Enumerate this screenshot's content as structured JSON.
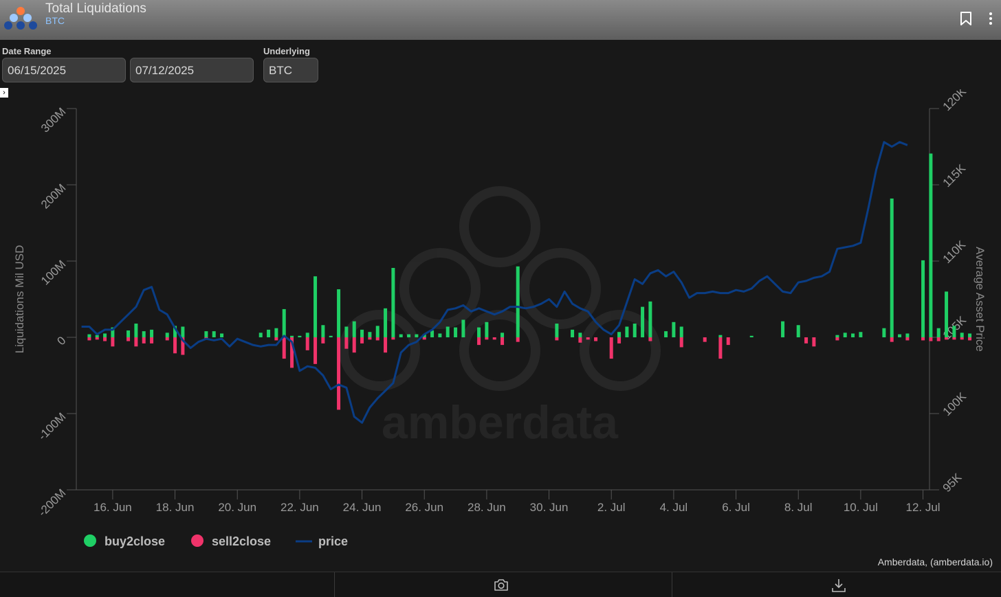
{
  "header": {
    "title": "Total Liquidations",
    "subtitle": "BTC",
    "bookmark_icon": "bookmark-icon",
    "menu_icon": "more-vertical-icon"
  },
  "filters": {
    "date_range_label": "Date Range",
    "start_date": "06/15/2025",
    "end_date": "07/12/2025",
    "underlying_label": "Underlying",
    "underlying": "BTC"
  },
  "credit": "Amberdata, (amberdata.io)",
  "footer": {
    "camera_icon": "camera-icon",
    "download_icon": "download-icon"
  },
  "colors": {
    "buy": "#1fcf65",
    "sell": "#f0336a",
    "price": "#0a3d85",
    "background": "#181818"
  },
  "chart_data": {
    "type": "bar",
    "ylabel": "Liquidations Mil USD",
    "y2label": "Average Asset Price",
    "ylim": [
      -200,
      300
    ],
    "y2lim": [
      95000,
      120000
    ],
    "yticks": [
      "300M",
      "200M",
      "100M",
      "0",
      "-100M",
      "-200M"
    ],
    "y2ticks": [
      "120K",
      "115K",
      "110K",
      "105K",
      "100K",
      "95K"
    ],
    "xticks": [
      "16. Jun",
      "18. Jun",
      "20. Jun",
      "22. Jun",
      "24. Jun",
      "26. Jun",
      "28. Jun",
      "30. Jun",
      "2. Jul",
      "4. Jul",
      "6. Jul",
      "8. Jul",
      "10. Jul",
      "12. Jul"
    ],
    "xlim": [
      "2025-06-14T20:00",
      "2025-07-12T05:00"
    ],
    "watermark": "amberdata",
    "legend": {
      "position": "bottom-left",
      "entries": [
        "buy2close",
        "sell2close",
        "price"
      ]
    },
    "series": [
      {
        "name": "buy2close",
        "unit": "M USD",
        "points": [
          [
            "2025-06-15T06:00",
            4
          ],
          [
            "2025-06-15T12:00",
            3
          ],
          [
            "2025-06-15T18:00",
            5
          ],
          [
            "2025-06-16T00:00",
            13
          ],
          [
            "2025-06-16T12:00",
            9
          ],
          [
            "2025-06-16T18:00",
            18
          ],
          [
            "2025-06-17T00:00",
            8
          ],
          [
            "2025-06-17T06:00",
            10
          ],
          [
            "2025-06-17T18:00",
            6
          ],
          [
            "2025-06-18T00:00",
            15
          ],
          [
            "2025-06-18T06:00",
            14
          ],
          [
            "2025-06-19T00:00",
            8
          ],
          [
            "2025-06-19T06:00",
            8
          ],
          [
            "2025-06-19T12:00",
            5
          ],
          [
            "2025-06-20T18:00",
            6
          ],
          [
            "2025-06-21T00:00",
            10
          ],
          [
            "2025-06-21T06:00",
            12
          ],
          [
            "2025-06-21T12:00",
            37
          ],
          [
            "2025-06-21T18:00",
            2
          ],
          [
            "2025-06-22T00:00",
            2
          ],
          [
            "2025-06-22T06:00",
            6
          ],
          [
            "2025-06-22T12:00",
            80
          ],
          [
            "2025-06-22T18:00",
            16
          ],
          [
            "2025-06-23T00:00",
            2
          ],
          [
            "2025-06-23T06:00",
            63
          ],
          [
            "2025-06-23T12:00",
            14
          ],
          [
            "2025-06-23T18:00",
            21
          ],
          [
            "2025-06-24T00:00",
            10
          ],
          [
            "2025-06-24T06:00",
            7
          ],
          [
            "2025-06-24T12:00",
            15
          ],
          [
            "2025-06-24T18:00",
            38
          ],
          [
            "2025-06-25T00:00",
            91
          ],
          [
            "2025-06-25T06:00",
            4
          ],
          [
            "2025-06-25T12:00",
            4
          ],
          [
            "2025-06-25T18:00",
            4
          ],
          [
            "2025-06-26T00:00",
            4
          ],
          [
            "2025-06-26T06:00",
            9
          ],
          [
            "2025-06-26T12:00",
            5
          ],
          [
            "2025-06-26T18:00",
            14
          ],
          [
            "2025-06-27T00:00",
            13
          ],
          [
            "2025-06-27T06:00",
            23
          ],
          [
            "2025-06-27T18:00",
            13
          ],
          [
            "2025-06-28T00:00",
            20
          ],
          [
            "2025-06-28T12:00",
            6
          ],
          [
            "2025-06-29T00:00",
            93
          ],
          [
            "2025-06-30T06:00",
            18
          ],
          [
            "2025-06-30T18:00",
            10
          ],
          [
            "2025-07-01T00:00",
            6
          ],
          [
            "2025-07-02T06:00",
            7
          ],
          [
            "2025-07-02T12:00",
            14
          ],
          [
            "2025-07-02T18:00",
            18
          ],
          [
            "2025-07-03T00:00",
            40
          ],
          [
            "2025-07-03T06:00",
            47
          ],
          [
            "2025-07-03T18:00",
            8
          ],
          [
            "2025-07-04T00:00",
            20
          ],
          [
            "2025-07-04T06:00",
            14
          ],
          [
            "2025-07-05T12:00",
            3
          ],
          [
            "2025-07-06T12:00",
            2
          ],
          [
            "2025-07-07T12:00",
            21
          ],
          [
            "2025-07-08T00:00",
            16
          ],
          [
            "2025-07-09T06:00",
            3
          ],
          [
            "2025-07-09T12:00",
            6
          ],
          [
            "2025-07-09T18:00",
            5
          ],
          [
            "2025-07-10T00:00",
            7
          ],
          [
            "2025-07-10T18:00",
            12
          ],
          [
            "2025-07-11T00:00",
            182
          ],
          [
            "2025-07-11T06:00",
            4
          ],
          [
            "2025-07-11T12:00",
            5
          ],
          [
            "2025-07-12T00:00",
            101
          ],
          [
            "2025-07-12T06:00",
            241
          ],
          [
            "2025-07-12T12:00",
            12
          ],
          [
            "2025-07-12T18:00",
            60
          ],
          [
            "2025-07-13T00:00",
            15
          ],
          [
            "2025-07-13T06:00",
            6
          ],
          [
            "2025-07-13T12:00",
            5
          ]
        ]
      },
      {
        "name": "sell2close",
        "unit": "M USD",
        "points": [
          [
            "2025-06-15T06:00",
            -4
          ],
          [
            "2025-06-15T12:00",
            -3
          ],
          [
            "2025-06-15T18:00",
            -5
          ],
          [
            "2025-06-16T00:00",
            -12
          ],
          [
            "2025-06-16T12:00",
            -5
          ],
          [
            "2025-06-16T18:00",
            -12
          ],
          [
            "2025-06-17T00:00",
            -8
          ],
          [
            "2025-06-17T06:00",
            -8
          ],
          [
            "2025-06-17T18:00",
            -4
          ],
          [
            "2025-06-18T00:00",
            -21
          ],
          [
            "2025-06-18T06:00",
            -23
          ],
          [
            "2025-06-19T00:00",
            -3
          ],
          [
            "2025-06-21T06:00",
            -4
          ],
          [
            "2025-06-21T12:00",
            -28
          ],
          [
            "2025-06-21T18:00",
            -40
          ],
          [
            "2025-06-22T06:00",
            -17
          ],
          [
            "2025-06-22T12:00",
            -35
          ],
          [
            "2025-06-22T18:00",
            -8
          ],
          [
            "2025-06-23T06:00",
            -95
          ],
          [
            "2025-06-23T12:00",
            -15
          ],
          [
            "2025-06-23T18:00",
            -20
          ],
          [
            "2025-06-24T00:00",
            -8
          ],
          [
            "2025-06-24T06:00",
            -3
          ],
          [
            "2025-06-24T12:00",
            -4
          ],
          [
            "2025-06-24T18:00",
            -20
          ],
          [
            "2025-06-25T00:00",
            -3
          ],
          [
            "2025-06-26T00:00",
            -3
          ],
          [
            "2025-06-27T18:00",
            -10
          ],
          [
            "2025-06-28T00:00",
            -3
          ],
          [
            "2025-06-28T06:00",
            -3
          ],
          [
            "2025-06-28T12:00",
            -10
          ],
          [
            "2025-06-29T00:00",
            -6
          ],
          [
            "2025-06-30T06:00",
            -4
          ],
          [
            "2025-07-01T00:00",
            -7
          ],
          [
            "2025-07-01T06:00",
            -3
          ],
          [
            "2025-07-01T12:00",
            -5
          ],
          [
            "2025-07-02T00:00",
            -28
          ],
          [
            "2025-07-02T06:00",
            -8
          ],
          [
            "2025-07-03T06:00",
            -5
          ],
          [
            "2025-07-04T06:00",
            -13
          ],
          [
            "2025-07-05T00:00",
            -6
          ],
          [
            "2025-07-05T12:00",
            -28
          ],
          [
            "2025-07-05T18:00",
            -10
          ],
          [
            "2025-07-08T06:00",
            -8
          ],
          [
            "2025-07-08T12:00",
            -12
          ],
          [
            "2025-07-09T06:00",
            -4
          ],
          [
            "2025-07-11T00:00",
            -6
          ],
          [
            "2025-07-11T12:00",
            -4
          ],
          [
            "2025-07-12T00:00",
            -4
          ],
          [
            "2025-07-12T06:00",
            -5
          ],
          [
            "2025-07-12T12:00",
            -5
          ],
          [
            "2025-07-12T18:00",
            -3
          ],
          [
            "2025-07-13T00:00",
            -3
          ],
          [
            "2025-07-13T06:00",
            -3
          ],
          [
            "2025-07-13T12:00",
            -4
          ]
        ]
      },
      {
        "name": "price",
        "unit": "USD",
        "points": [
          [
            "2025-06-15T00:00",
            105700
          ],
          [
            "2025-06-15T06:00",
            105700
          ],
          [
            "2025-06-15T12:00",
            105200
          ],
          [
            "2025-06-15T18:00",
            105500
          ],
          [
            "2025-06-16T00:00",
            105500
          ],
          [
            "2025-06-16T06:00",
            106000
          ],
          [
            "2025-06-16T12:00",
            106500
          ],
          [
            "2025-06-16T18:00",
            107000
          ],
          [
            "2025-06-17T00:00",
            108100
          ],
          [
            "2025-06-17T06:00",
            108300
          ],
          [
            "2025-06-17T12:00",
            106800
          ],
          [
            "2025-06-17T18:00",
            106500
          ],
          [
            "2025-06-18T00:00",
            105600
          ],
          [
            "2025-06-18T06:00",
            104800
          ],
          [
            "2025-06-18T12:00",
            104300
          ],
          [
            "2025-06-18T18:00",
            104700
          ],
          [
            "2025-06-19T00:00",
            104900
          ],
          [
            "2025-06-19T06:00",
            104800
          ],
          [
            "2025-06-19T12:00",
            104900
          ],
          [
            "2025-06-19T18:00",
            104400
          ],
          [
            "2025-06-20T00:00",
            104900
          ],
          [
            "2025-06-20T06:00",
            104700
          ],
          [
            "2025-06-20T12:00",
            104500
          ],
          [
            "2025-06-20T18:00",
            104400
          ],
          [
            "2025-06-21T00:00",
            104500
          ],
          [
            "2025-06-21T06:00",
            104500
          ],
          [
            "2025-06-21T12:00",
            105100
          ],
          [
            "2025-06-21T18:00",
            104700
          ],
          [
            "2025-06-22T00:00",
            102800
          ],
          [
            "2025-06-22T06:00",
            103100
          ],
          [
            "2025-06-22T12:00",
            103000
          ],
          [
            "2025-06-22T18:00",
            102500
          ],
          [
            "2025-06-23T00:00",
            101600
          ],
          [
            "2025-06-23T06:00",
            101900
          ],
          [
            "2025-06-23T12:00",
            101700
          ],
          [
            "2025-06-23T18:00",
            99800
          ],
          [
            "2025-06-24T00:00",
            99400
          ],
          [
            "2025-06-24T06:00",
            100400
          ],
          [
            "2025-06-24T12:00",
            101000
          ],
          [
            "2025-06-24T18:00",
            101500
          ],
          [
            "2025-06-25T00:00",
            102000
          ],
          [
            "2025-06-25T06:00",
            104000
          ],
          [
            "2025-06-25T12:00",
            104500
          ],
          [
            "2025-06-25T18:00",
            104700
          ],
          [
            "2025-06-26T00:00",
            105200
          ],
          [
            "2025-06-26T06:00",
            105500
          ],
          [
            "2025-06-26T12:00",
            106000
          ],
          [
            "2025-06-26T18:00",
            106800
          ],
          [
            "2025-06-27T00:00",
            106900
          ],
          [
            "2025-06-27T06:00",
            107100
          ],
          [
            "2025-06-27T12:00",
            106700
          ],
          [
            "2025-06-27T18:00",
            106900
          ],
          [
            "2025-06-28T00:00",
            106700
          ],
          [
            "2025-06-28T06:00",
            106500
          ],
          [
            "2025-06-28T12:00",
            106700
          ],
          [
            "2025-06-28T18:00",
            107000
          ],
          [
            "2025-06-29T00:00",
            107000
          ],
          [
            "2025-06-29T06:00",
            106900
          ],
          [
            "2025-06-29T12:00",
            107000
          ],
          [
            "2025-06-29T18:00",
            107200
          ],
          [
            "2025-06-30T00:00",
            107500
          ],
          [
            "2025-06-30T06:00",
            107000
          ],
          [
            "2025-06-30T12:00",
            108000
          ],
          [
            "2025-06-30T18:00",
            107200
          ],
          [
            "2025-07-01T00:00",
            106900
          ],
          [
            "2025-07-01T06:00",
            106700
          ],
          [
            "2025-07-01T12:00",
            106000
          ],
          [
            "2025-07-01T18:00",
            105500
          ],
          [
            "2025-07-02T00:00",
            105200
          ],
          [
            "2025-07-02T06:00",
            105800
          ],
          [
            "2025-07-02T12:00",
            107300
          ],
          [
            "2025-07-02T18:00",
            108800
          ],
          [
            "2025-07-03T00:00",
            108500
          ],
          [
            "2025-07-03T06:00",
            109200
          ],
          [
            "2025-07-03T12:00",
            109400
          ],
          [
            "2025-07-03T18:00",
            109000
          ],
          [
            "2025-07-04T00:00",
            109300
          ],
          [
            "2025-07-04T06:00",
            108600
          ],
          [
            "2025-07-04T12:00",
            107600
          ],
          [
            "2025-07-04T18:00",
            107900
          ],
          [
            "2025-07-05T00:00",
            107900
          ],
          [
            "2025-07-05T06:00",
            108000
          ],
          [
            "2025-07-05T12:00",
            107900
          ],
          [
            "2025-07-05T18:00",
            107900
          ],
          [
            "2025-07-06T00:00",
            108100
          ],
          [
            "2025-07-06T06:00",
            108000
          ],
          [
            "2025-07-06T12:00",
            108200
          ],
          [
            "2025-07-06T18:00",
            108700
          ],
          [
            "2025-07-07T00:00",
            109000
          ],
          [
            "2025-07-07T06:00",
            108500
          ],
          [
            "2025-07-07T12:00",
            108000
          ],
          [
            "2025-07-07T18:00",
            107900
          ],
          [
            "2025-07-08T00:00",
            108600
          ],
          [
            "2025-07-08T06:00",
            108700
          ],
          [
            "2025-07-08T12:00",
            108900
          ],
          [
            "2025-07-08T18:00",
            109000
          ],
          [
            "2025-07-09T00:00",
            109300
          ],
          [
            "2025-07-09T06:00",
            110800
          ],
          [
            "2025-07-09T12:00",
            110900
          ],
          [
            "2025-07-09T18:00",
            111000
          ],
          [
            "2025-07-10T00:00",
            111200
          ],
          [
            "2025-07-10T06:00",
            113500
          ],
          [
            "2025-07-10T12:00",
            116000
          ],
          [
            "2025-07-10T18:00",
            117800
          ],
          [
            "2025-07-11T00:00",
            117500
          ],
          [
            "2025-07-11T06:00",
            117800
          ],
          [
            "2025-07-11T12:00",
            117600
          ]
        ]
      }
    ]
  }
}
